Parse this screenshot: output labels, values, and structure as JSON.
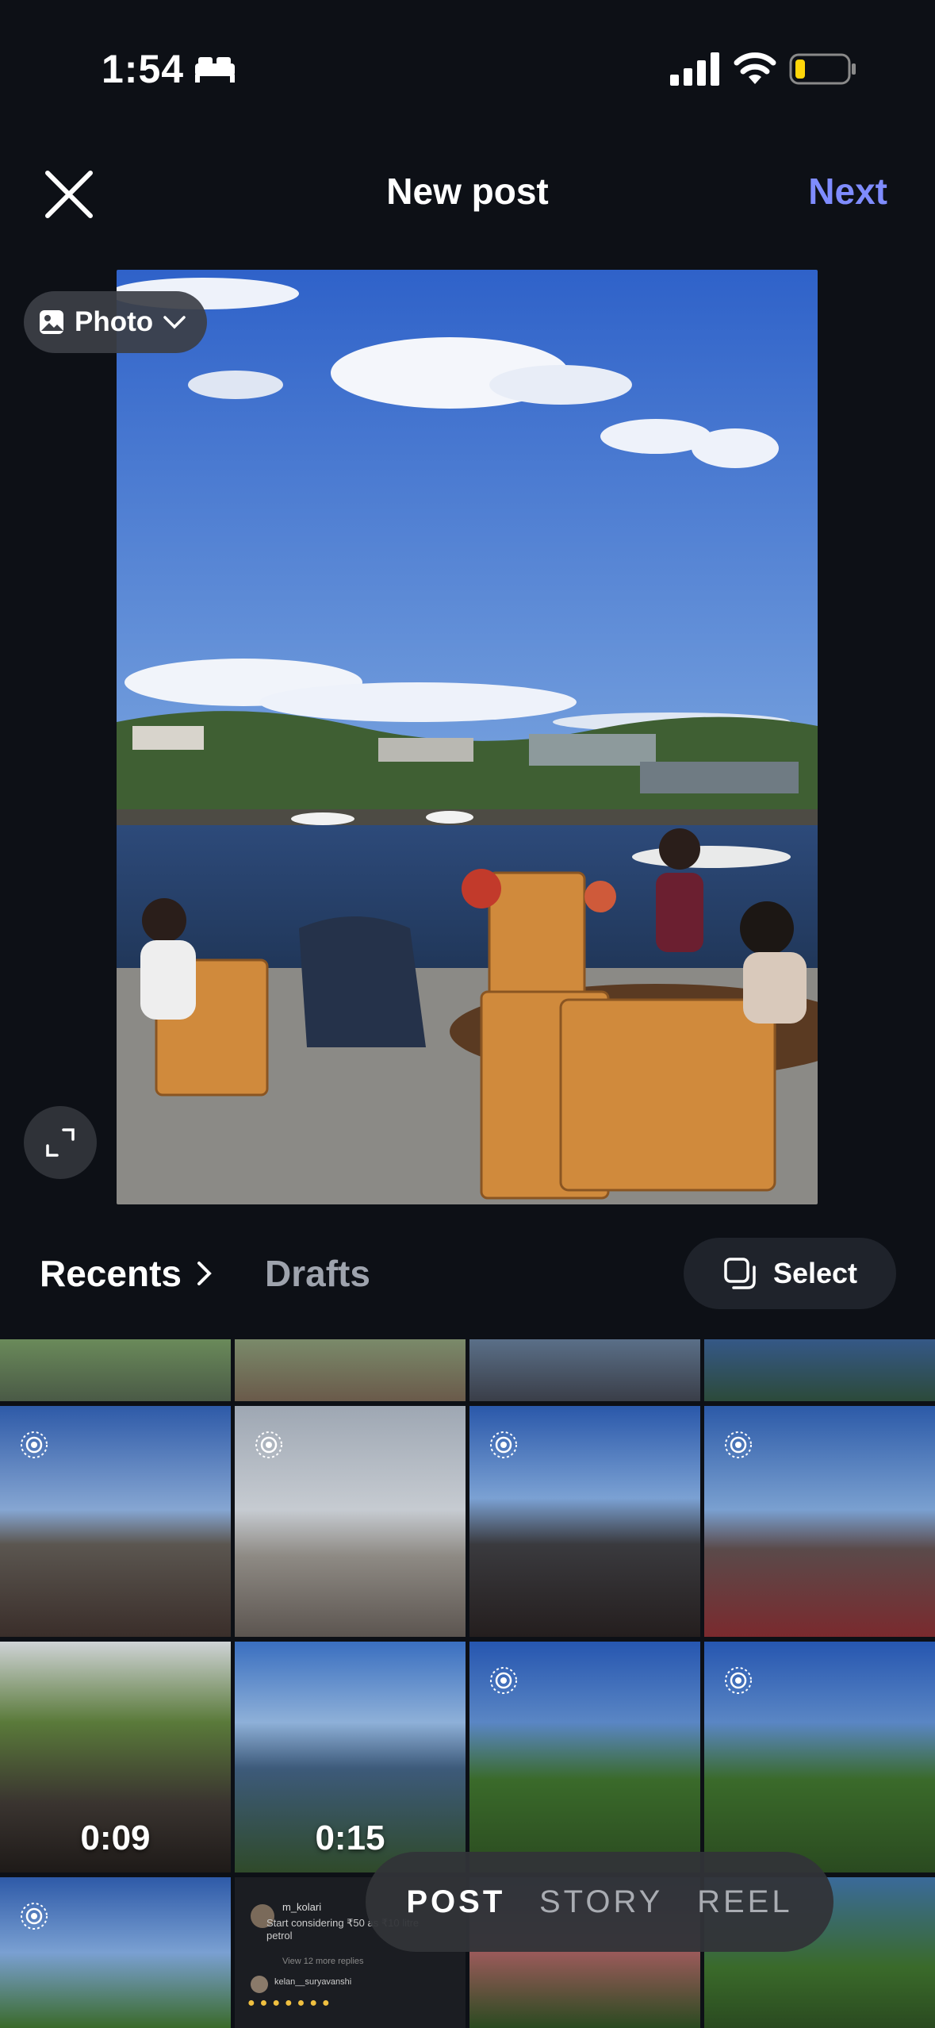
{
  "status_bar": {
    "time": "1:54"
  },
  "header": {
    "title": "New post",
    "next_label": "Next"
  },
  "preview": {
    "type_selector_label": "Photo"
  },
  "gallery": {
    "recents_label": "Recents",
    "drafts_label": "Drafts",
    "select_label": "Select"
  },
  "tiles": {
    "r2c1_duration": "0:09",
    "r2c2_duration": "0:15",
    "comment_user": "m_kolari",
    "comment_text": "Start considering ₹50 as ₹10 litre petrol",
    "comment_replies": "View 12 more replies",
    "comment_user2": "kelan__suryavanshi"
  },
  "modes": [
    "POST",
    "STORY",
    "REEL"
  ],
  "colors": {
    "accent": "#7f8cff",
    "background": "#0d1016"
  }
}
